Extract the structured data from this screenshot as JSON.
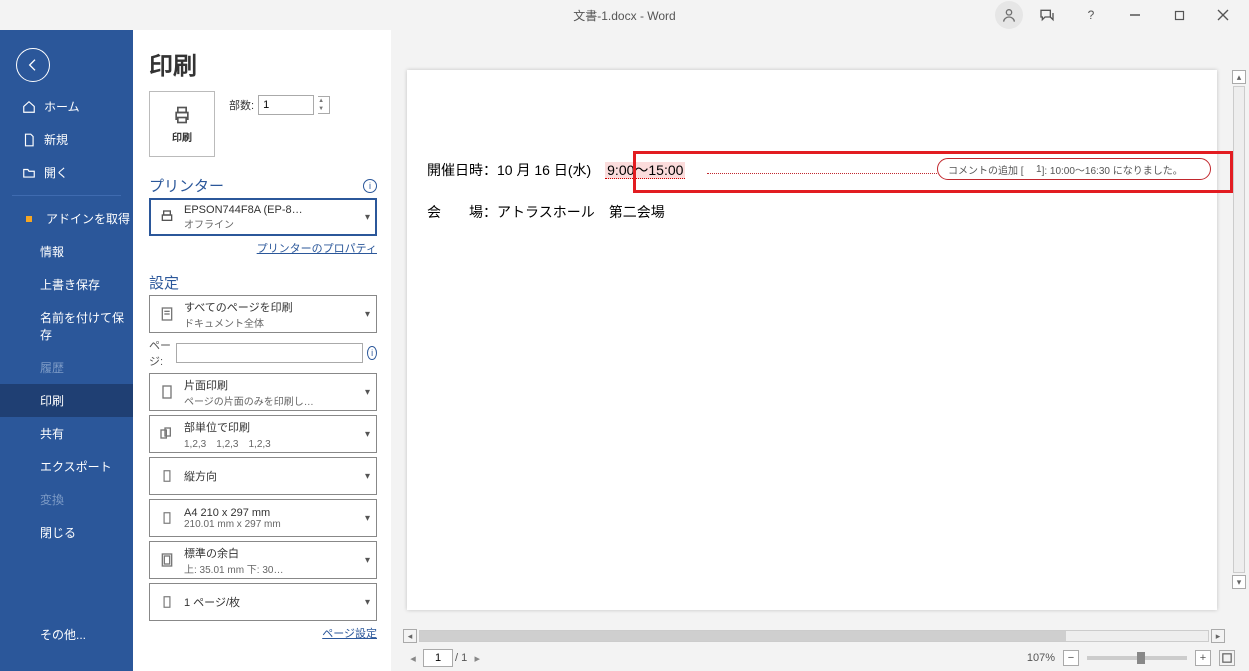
{
  "titlebar": {
    "title": "文書-1.docx - Word"
  },
  "sidebar": {
    "home": "ホーム",
    "new": "新規",
    "open": "開く",
    "getaddins": "アドインを取得",
    "info": "情報",
    "save": "上書き保存",
    "saveas": "名前を付けて保存",
    "history": "履歴",
    "print": "印刷",
    "share": "共有",
    "export": "エクスポート",
    "transform": "変換",
    "close": "閉じる",
    "other": "その他..."
  },
  "panel": {
    "heading": "印刷",
    "print_tile": "印刷",
    "copies_label": "部数:",
    "copies_value": "1",
    "printer_section": "プリンター",
    "printer_name": "EPSON744F8A (EP-8…",
    "printer_status": "オフライン",
    "printer_props": "プリンターのプロパティ",
    "settings_section": "設定",
    "pages_label": "ページ:",
    "page_setup": "ページ設定",
    "opt_allpages_l1": "すべてのページを印刷",
    "opt_allpages_l2": "ドキュメント全体",
    "opt_oneside_l1": "片面印刷",
    "opt_oneside_l2": "ページの片面のみを印刷し…",
    "opt_collate_l1": "部単位で印刷",
    "opt_collate_l2": "1,2,3　1,2,3　1,2,3",
    "opt_orient_l1": "縦方向",
    "opt_paper_l1": "A4 210 x 297 mm",
    "opt_paper_l2": "210.01 mm x 297 mm",
    "opt_margin_l1": "標準の余白",
    "opt_margin_l2": "上: 35.01 mm 下: 30…",
    "opt_ppsheet_l1": "1 ページ/枚"
  },
  "document": {
    "line1_label": "開催日時：10 月 16 日(水)",
    "line1_time": "9:00～15:00",
    "line2": "会　　場：アトラスホール　第二会場"
  },
  "comment": {
    "prefix": "コメントの追加 [",
    "num": "1",
    "suffix": "]: 10:00～16:30 になりました。"
  },
  "status": {
    "page_current": "1",
    "page_sep": "/ 1",
    "zoom": "107%"
  }
}
